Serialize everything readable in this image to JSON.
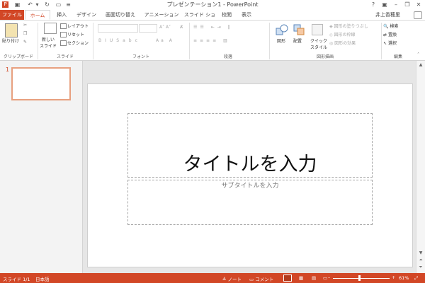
{
  "app": {
    "window_title": "プレゼンテーション1 - PowerPoint",
    "user": "井上香穂里",
    "help": "?"
  },
  "tabs": [
    {
      "label": "ファイル"
    },
    {
      "label": "ホーム"
    },
    {
      "label": "挿入"
    },
    {
      "label": "デザイン"
    },
    {
      "label": "画面切り替え"
    },
    {
      "label": "アニメーション"
    },
    {
      "label": "スライド ショー"
    },
    {
      "label": "校閲"
    },
    {
      "label": "表示"
    }
  ],
  "ribbon": {
    "clipboard": {
      "paste": "貼り付け",
      "label": "クリップボード"
    },
    "slides": {
      "new_slide_1": "新しい",
      "new_slide_2": "スライド",
      "layout": "レイアウト",
      "reset": "リセット",
      "section": "セクション",
      "label": "スライド"
    },
    "font": {
      "label": "フォント"
    },
    "paragraph": {
      "label": "段落"
    },
    "drawing": {
      "shapes": "図形",
      "arrange": "配置",
      "quick_1": "クイック",
      "quick_2": "スタイル",
      "fill": "図形の塗りつぶし",
      "outline": "図形の枠線",
      "effects": "図形の効果",
      "label": "図形描画"
    },
    "editing": {
      "find": "検索",
      "replace": "置換",
      "select": "選択",
      "label": "編集"
    }
  },
  "thumbnail": {
    "number": "1"
  },
  "slide": {
    "title_placeholder": "タイトルを入力",
    "subtitle_placeholder": "サブタイトルを入力"
  },
  "status": {
    "slide_info": "スライド 1/1",
    "language": "日本語",
    "notes": "ノート",
    "comments": "コメント",
    "zoom": "61%"
  },
  "colors": {
    "accent": "#d24726"
  }
}
